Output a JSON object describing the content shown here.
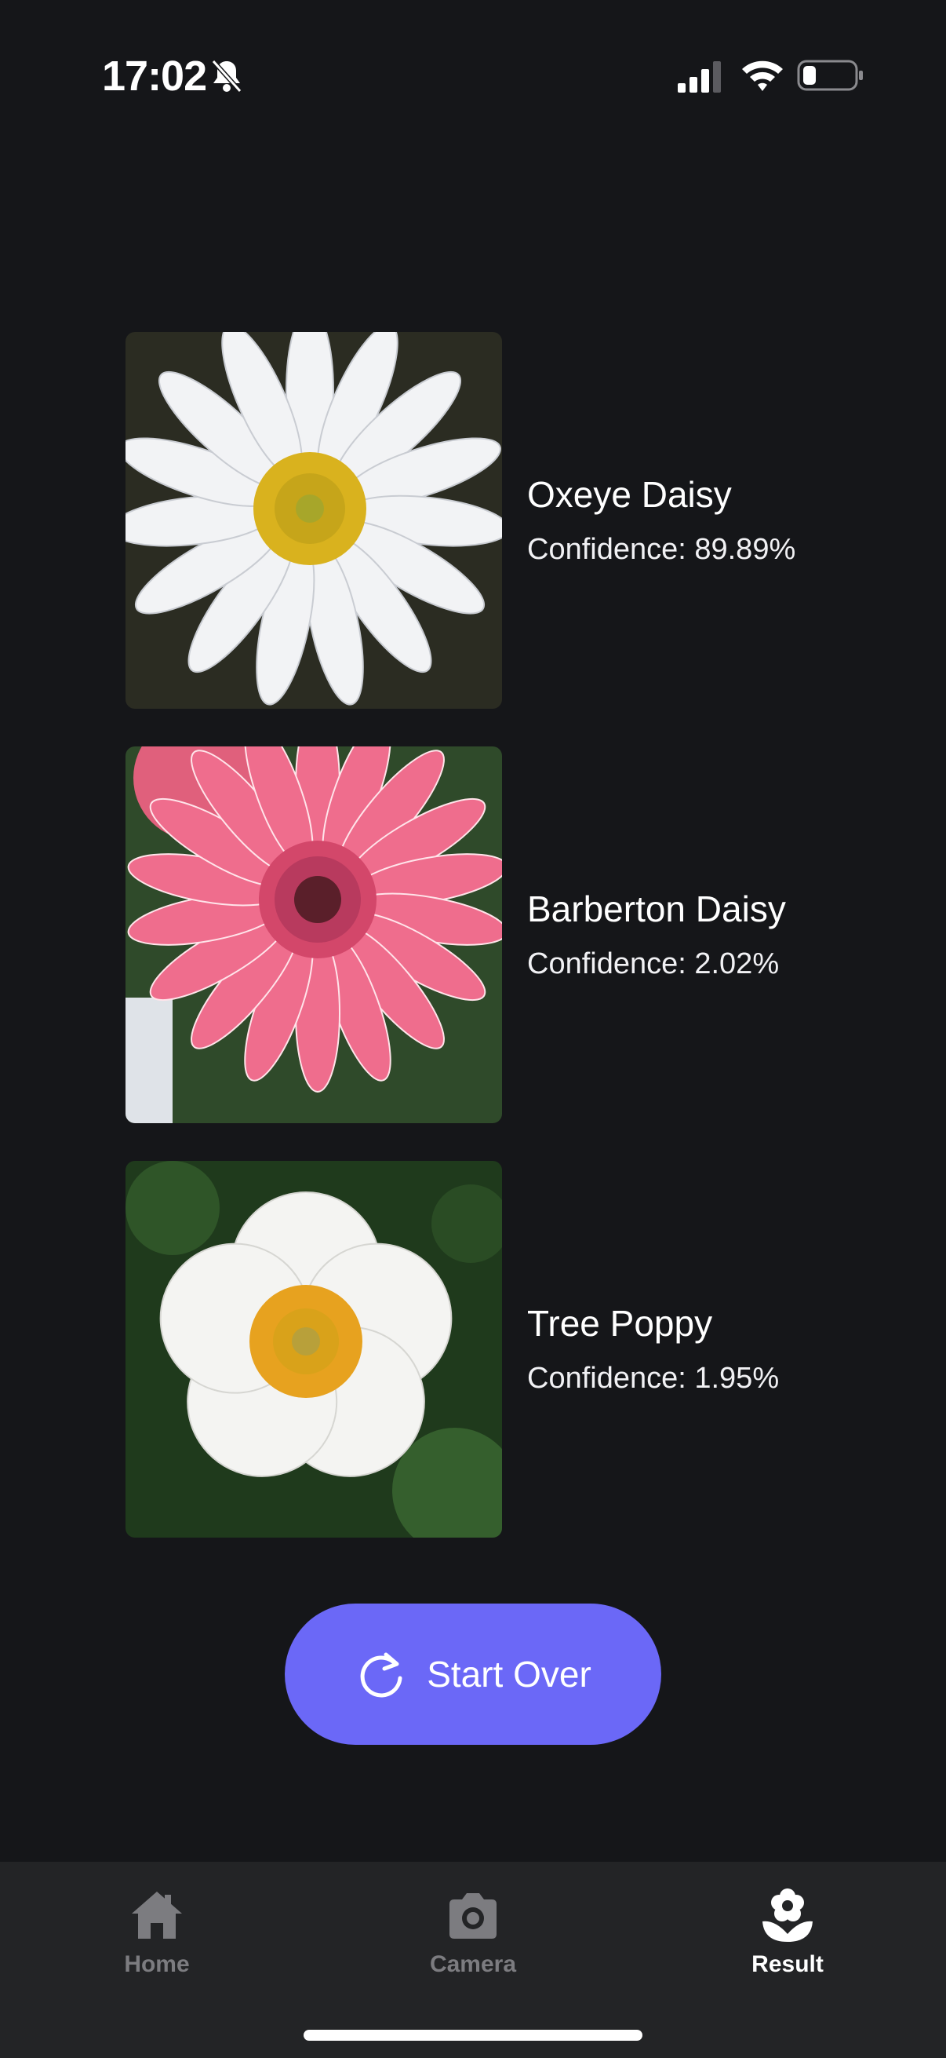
{
  "status_bar": {
    "time": "17:02",
    "icons": [
      "bell-slash-icon",
      "cellular-signal-icon",
      "wifi-icon",
      "battery-icon"
    ]
  },
  "results": [
    {
      "name": "Oxeye Daisy",
      "confidence": "Confidence: 89.89%",
      "image": "white-daisy-photo"
    },
    {
      "name": "Barberton Daisy",
      "confidence": "Confidence: 2.02%",
      "image": "pink-gerbera-photo"
    },
    {
      "name": "Tree Poppy",
      "confidence": "Confidence: 1.95%",
      "image": "white-poppy-photo"
    }
  ],
  "start_over": {
    "label": "Start Over",
    "icon": "refresh-icon"
  },
  "tab_bar": {
    "tabs": [
      {
        "label": "Home",
        "icon": "house-icon",
        "active": false
      },
      {
        "label": "Camera",
        "icon": "camera-icon",
        "active": false
      },
      {
        "label": "Result",
        "icon": "flower-icon",
        "active": true
      }
    ]
  },
  "colors": {
    "background": "#151619",
    "accent": "#6b68f7",
    "tab_bar": "#232426",
    "tab_inactive": "#7c7c80"
  }
}
